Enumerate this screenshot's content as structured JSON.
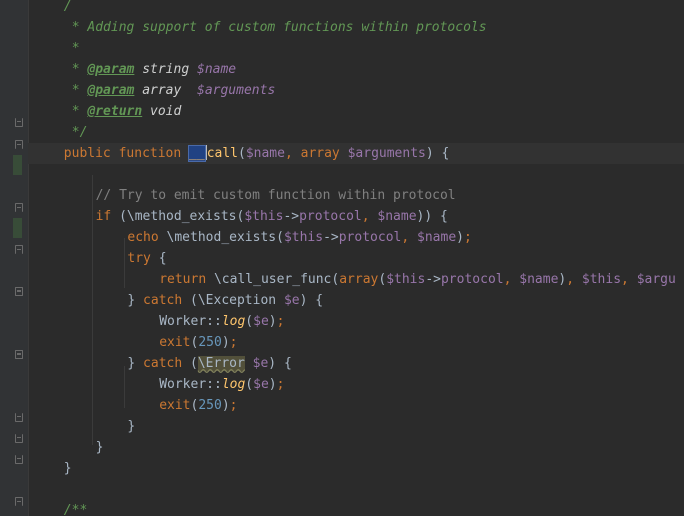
{
  "editor": {
    "lines": [
      {
        "tokens": [
          {
            "c": "doc",
            "t": "/"
          }
        ],
        "indent": 4
      },
      {
        "tokens": [
          {
            "c": "doc",
            "t": "* Adding support of custom functions within protocols"
          }
        ],
        "indent": 5
      },
      {
        "tokens": [
          {
            "c": "doc",
            "t": "*"
          }
        ],
        "indent": 5
      },
      {
        "tokens": [
          {
            "c": "doc",
            "t": "* "
          },
          {
            "c": "doc-tag",
            "t": "@param"
          },
          {
            "c": "doc-type",
            "t": " string "
          },
          {
            "c": "doc-var",
            "t": "$name"
          }
        ],
        "indent": 5
      },
      {
        "tokens": [
          {
            "c": "doc",
            "t": "* "
          },
          {
            "c": "doc-tag",
            "t": "@param"
          },
          {
            "c": "doc-type",
            "t": " array  "
          },
          {
            "c": "doc-var",
            "t": "$arguments"
          }
        ],
        "indent": 5
      },
      {
        "tokens": [
          {
            "c": "doc",
            "t": "* "
          },
          {
            "c": "doc-tag",
            "t": "@return"
          },
          {
            "c": "doc-type",
            "t": " void"
          }
        ],
        "indent": 5
      },
      {
        "tokens": [
          {
            "c": "doc",
            "t": "*/"
          }
        ],
        "indent": 5
      },
      {
        "tokens": [
          {
            "c": "kw",
            "t": "public function "
          },
          {
            "c": "hl",
            "t": "__"
          },
          {
            "c": "caret",
            "t": ""
          },
          {
            "c": "fn",
            "t": "call"
          },
          {
            "c": "txt",
            "t": "("
          },
          {
            "c": "var",
            "t": "$name"
          },
          {
            "c": "kw",
            "t": ", "
          },
          {
            "c": "kw",
            "t": "array "
          },
          {
            "c": "var",
            "t": "$arguments"
          },
          {
            "c": "txt",
            "t": ") {"
          }
        ],
        "indent": 4,
        "current": true
      },
      {
        "tokens": [],
        "indent": 0
      },
      {
        "tokens": [
          {
            "c": "cmt",
            "t": "// Try to emit custom function within protocol"
          }
        ],
        "indent": 8
      },
      {
        "tokens": [
          {
            "c": "kw",
            "t": "if "
          },
          {
            "c": "txt",
            "t": "(\\method_exists("
          },
          {
            "c": "var",
            "t": "$this"
          },
          {
            "c": "txt",
            "t": "->"
          },
          {
            "c": "var",
            "t": "protocol"
          },
          {
            "c": "kw",
            "t": ", "
          },
          {
            "c": "var",
            "t": "$name"
          },
          {
            "c": "txt",
            "t": ")) {"
          }
        ],
        "indent": 8
      },
      {
        "tokens": [
          {
            "c": "kw",
            "t": "echo "
          },
          {
            "c": "txt",
            "t": "\\method_exists("
          },
          {
            "c": "var",
            "t": "$this"
          },
          {
            "c": "txt",
            "t": "->"
          },
          {
            "c": "var",
            "t": "protocol"
          },
          {
            "c": "kw",
            "t": ", "
          },
          {
            "c": "var",
            "t": "$name"
          },
          {
            "c": "txt",
            "t": ")"
          },
          {
            "c": "kw",
            "t": ";"
          }
        ],
        "indent": 12
      },
      {
        "tokens": [
          {
            "c": "kw",
            "t": "try "
          },
          {
            "c": "txt",
            "t": "{"
          }
        ],
        "indent": 12
      },
      {
        "tokens": [
          {
            "c": "kw",
            "t": "return "
          },
          {
            "c": "txt",
            "t": "\\call_user_func("
          },
          {
            "c": "kw",
            "t": "array"
          },
          {
            "c": "txt",
            "t": "("
          },
          {
            "c": "var",
            "t": "$this"
          },
          {
            "c": "txt",
            "t": "->"
          },
          {
            "c": "var",
            "t": "protocol"
          },
          {
            "c": "kw",
            "t": ", "
          },
          {
            "c": "var",
            "t": "$name"
          },
          {
            "c": "txt",
            "t": ")"
          },
          {
            "c": "kw",
            "t": ", "
          },
          {
            "c": "var",
            "t": "$this"
          },
          {
            "c": "kw",
            "t": ", "
          },
          {
            "c": "var",
            "t": "$argu"
          }
        ],
        "indent": 16
      },
      {
        "tokens": [
          {
            "c": "txt",
            "t": "} "
          },
          {
            "c": "kw",
            "t": "catch "
          },
          {
            "c": "txt",
            "t": "(\\Exception "
          },
          {
            "c": "var",
            "t": "$e"
          },
          {
            "c": "txt",
            "t": ") {"
          }
        ],
        "indent": 12
      },
      {
        "tokens": [
          {
            "c": "txt",
            "t": "Worker::"
          },
          {
            "c": "static-call",
            "t": "log"
          },
          {
            "c": "txt",
            "t": "("
          },
          {
            "c": "var",
            "t": "$e"
          },
          {
            "c": "txt",
            "t": ")"
          },
          {
            "c": "kw",
            "t": ";"
          }
        ],
        "indent": 16
      },
      {
        "tokens": [
          {
            "c": "kw",
            "t": "exit"
          },
          {
            "c": "txt",
            "t": "("
          },
          {
            "c": "num",
            "t": "250"
          },
          {
            "c": "txt",
            "t": ")"
          },
          {
            "c": "kw",
            "t": ";"
          }
        ],
        "indent": 16
      },
      {
        "tokens": [
          {
            "c": "txt",
            "t": "} "
          },
          {
            "c": "kw",
            "t": "catch "
          },
          {
            "c": "txt",
            "t": "("
          },
          {
            "c": "warn",
            "t": "\\Error"
          },
          {
            "c": "txt",
            "t": " "
          },
          {
            "c": "var",
            "t": "$e"
          },
          {
            "c": "txt",
            "t": ") {"
          }
        ],
        "indent": 12
      },
      {
        "tokens": [
          {
            "c": "txt",
            "t": "Worker::"
          },
          {
            "c": "static-call",
            "t": "log"
          },
          {
            "c": "txt",
            "t": "("
          },
          {
            "c": "var",
            "t": "$e"
          },
          {
            "c": "txt",
            "t": ")"
          },
          {
            "c": "kw",
            "t": ";"
          }
        ],
        "indent": 16
      },
      {
        "tokens": [
          {
            "c": "kw",
            "t": "exit"
          },
          {
            "c": "txt",
            "t": "("
          },
          {
            "c": "num",
            "t": "250"
          },
          {
            "c": "txt",
            "t": ")"
          },
          {
            "c": "kw",
            "t": ";"
          }
        ],
        "indent": 16
      },
      {
        "tokens": [
          {
            "c": "txt",
            "t": "}"
          }
        ],
        "indent": 12
      },
      {
        "tokens": [
          {
            "c": "txt",
            "t": "}"
          }
        ],
        "indent": 8
      },
      {
        "tokens": [
          {
            "c": "txt",
            "t": "}"
          }
        ],
        "indent": 4
      },
      {
        "tokens": [],
        "indent": 0
      },
      {
        "tokens": [
          {
            "c": "doc",
            "t": "/**"
          }
        ],
        "indent": 4
      }
    ]
  }
}
